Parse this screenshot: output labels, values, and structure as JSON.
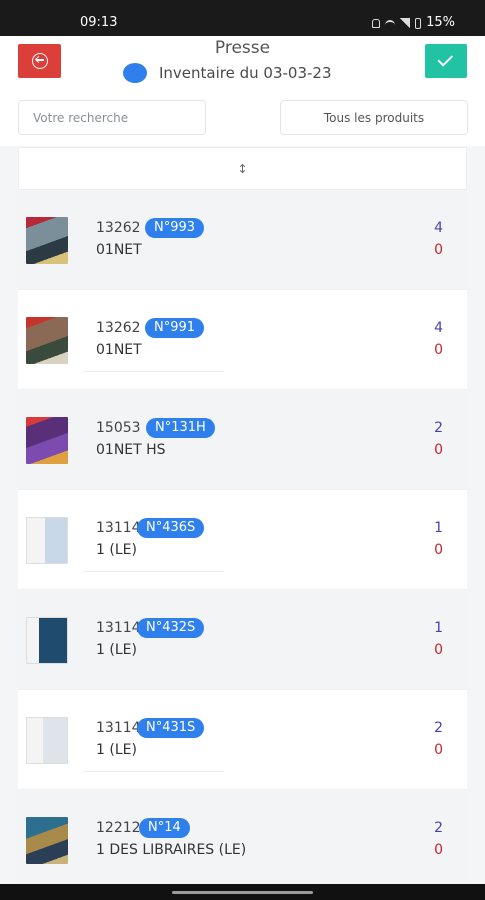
{
  "status_bar": {
    "time": "09:13",
    "battery": "15%"
  },
  "header": {
    "title": "Presse",
    "subtitle": "Inventaire du 03-03-23"
  },
  "filters": {
    "search_placeholder": "Votre recherche",
    "product_filter": "Tous les produits"
  },
  "list": {
    "sort_label": "↕",
    "items": [
      {
        "code": "13262",
        "issue": "N°993",
        "name": "01NET",
        "qty_top": "4",
        "qty_bottom": "0"
      },
      {
        "code": "13262",
        "issue": "N°991",
        "name": "01NET",
        "qty_top": "4",
        "qty_bottom": "0"
      },
      {
        "code": "15053",
        "issue": "N°131H",
        "name": "01NET HS",
        "qty_top": "2",
        "qty_bottom": "0"
      },
      {
        "code": "13114",
        "issue": "N°436S",
        "name": "1 (LE)",
        "qty_top": "1",
        "qty_bottom": "0"
      },
      {
        "code": "13114",
        "issue": "N°432S",
        "name": "1 (LE)",
        "qty_top": "1",
        "qty_bottom": "0"
      },
      {
        "code": "13114",
        "issue": "N°431S",
        "name": "1 (LE)",
        "qty_top": "2",
        "qty_bottom": "0"
      },
      {
        "code": "12212",
        "issue": "N°14",
        "name": "1 DES LIBRAIRES (LE)",
        "qty_top": "2",
        "qty_bottom": "0"
      }
    ]
  },
  "colors": {
    "back_button": "#dc3f3a",
    "validate_button": "#22c3a5",
    "badge": "#2f80ed",
    "qty_top": "#4b3fae",
    "qty_bottom": "#c0262d"
  },
  "icons": {
    "back": "back-circle-icon",
    "validate": "check-icon",
    "status_dot": "blue-dot"
  }
}
